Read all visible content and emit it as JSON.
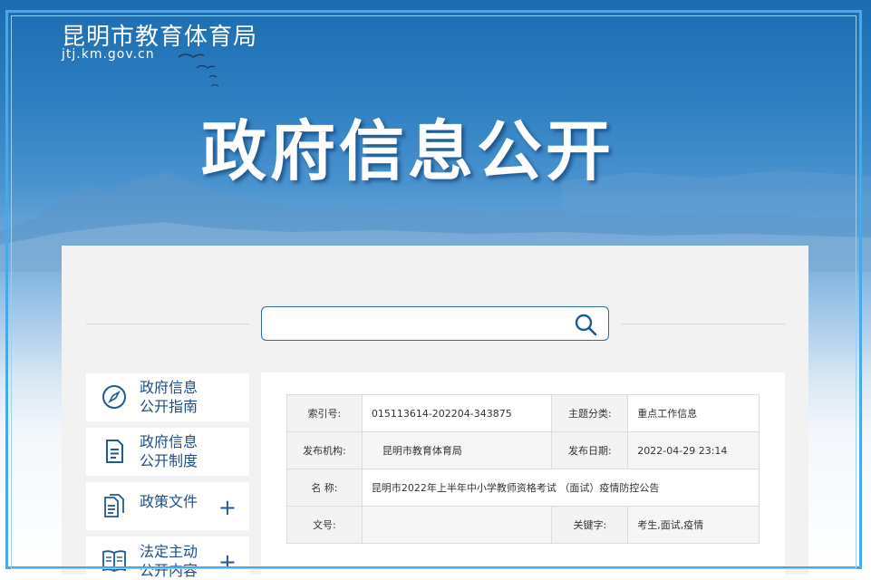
{
  "header": {
    "site_name": "昆明市教育体育局",
    "site_url": "jtj.km.gov.cn",
    "banner_title": "政府信息公开"
  },
  "search": {
    "placeholder": "",
    "value": ""
  },
  "sidebar": {
    "items": [
      {
        "label_line1": "政府信息",
        "label_line2": "公开指南",
        "icon": "compass-icon",
        "expandable": false
      },
      {
        "label_line1": "政府信息",
        "label_line2": "公开制度",
        "icon": "document-icon",
        "expandable": false
      },
      {
        "label_line1": "政策文件",
        "label_line2": "",
        "icon": "files-icon",
        "expandable": true,
        "expand_symbol": "+"
      },
      {
        "label_line1": "法定主动",
        "label_line2": "公开内容",
        "icon": "book-icon",
        "expandable": true,
        "expand_symbol": "+"
      }
    ]
  },
  "document_meta": {
    "index_label": "索引号:",
    "index_value": "015113614-202204-343875",
    "category_label": "主题分类:",
    "category_value": "重点工作信息",
    "publisher_label": "发布机构:",
    "publisher_value": "昆明市教育体育局",
    "date_label": "发布日期:",
    "date_value": "2022-04-29 23:14",
    "name_label": "名  称:",
    "name_value": "昆明市2022年上半年中小学教师资格考试 （面试）疫情防控公告",
    "docno_label": "文号:",
    "docno_value": "",
    "keywords_label": "关键字:",
    "keywords_value": "考生,面试,疫情"
  },
  "colors": {
    "header_blue": "#1b6bb0",
    "frame_blue": "#4aa8e8",
    "nav_text": "#1f4e87",
    "panel_bg": "#f2f2f2"
  }
}
